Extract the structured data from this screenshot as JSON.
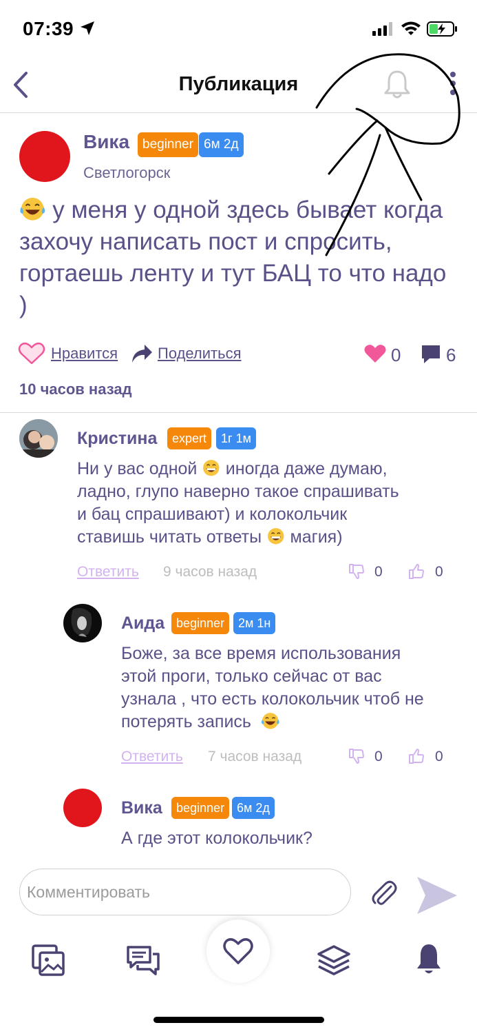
{
  "status": {
    "time": "07:39"
  },
  "nav": {
    "title": "Публикация"
  },
  "post": {
    "author": "Вика",
    "level": "beginner",
    "duration": "6м 2д",
    "city": "Светлогорск",
    "text": "у меня у одной здесь бывает когда захочу написать пост и спросить, гортаешь ленту и тут БАЦ то что надо )",
    "like_label": "Нравится",
    "share_label": "Поделиться",
    "likes": "0",
    "comments": "6",
    "time": "10 часов назад"
  },
  "comments": [
    {
      "author": "Кристина",
      "level": "expert",
      "duration": "1г 1м",
      "line1_a": "Ни у вас одной",
      "line1_b": "иногда даже думаю,",
      "line2": "ладно, глупо наверно такое спрашивать",
      "line3": "и бац спрашивают) и колокольчик",
      "line4_a": "ставишь читать ответы",
      "line4_b": "магия)",
      "reply_label": "Ответить",
      "time": "9 часов назад",
      "dislikes": "0",
      "likes": "0"
    },
    {
      "author": "Аида",
      "level": "beginner",
      "duration": "2м 1н",
      "line1": "Боже, за все время использования",
      "line2": "этой проги, только сейчас от вас",
      "line3": "узнала , что есть колокольчик чтоб не",
      "line4": "потерять запись",
      "reply_label": "Ответить",
      "time": "7 часов назад",
      "dislikes": "0",
      "likes": "0"
    },
    {
      "author": "Вика",
      "level": "beginner",
      "duration": "6м 2д",
      "line1": "А где этот колокольчик?"
    }
  ],
  "composer": {
    "placeholder": "Комментировать"
  },
  "colors": {
    "accent": "#5a5189",
    "badge_orange": "#f5870a",
    "badge_blue": "#3b8cf0",
    "heart_pink": "#f0589a",
    "avatar_red": "#e0161c"
  },
  "icons": [
    "back-chevron-icon",
    "bell-icon",
    "more-vertical-icon",
    "heart-outline-icon",
    "share-arrow-icon",
    "heart-filled-icon",
    "comment-icon",
    "thumbs-down-icon",
    "thumbs-up-icon",
    "paperclip-icon",
    "send-icon",
    "photos-icon",
    "chat-icon",
    "layers-icon"
  ]
}
